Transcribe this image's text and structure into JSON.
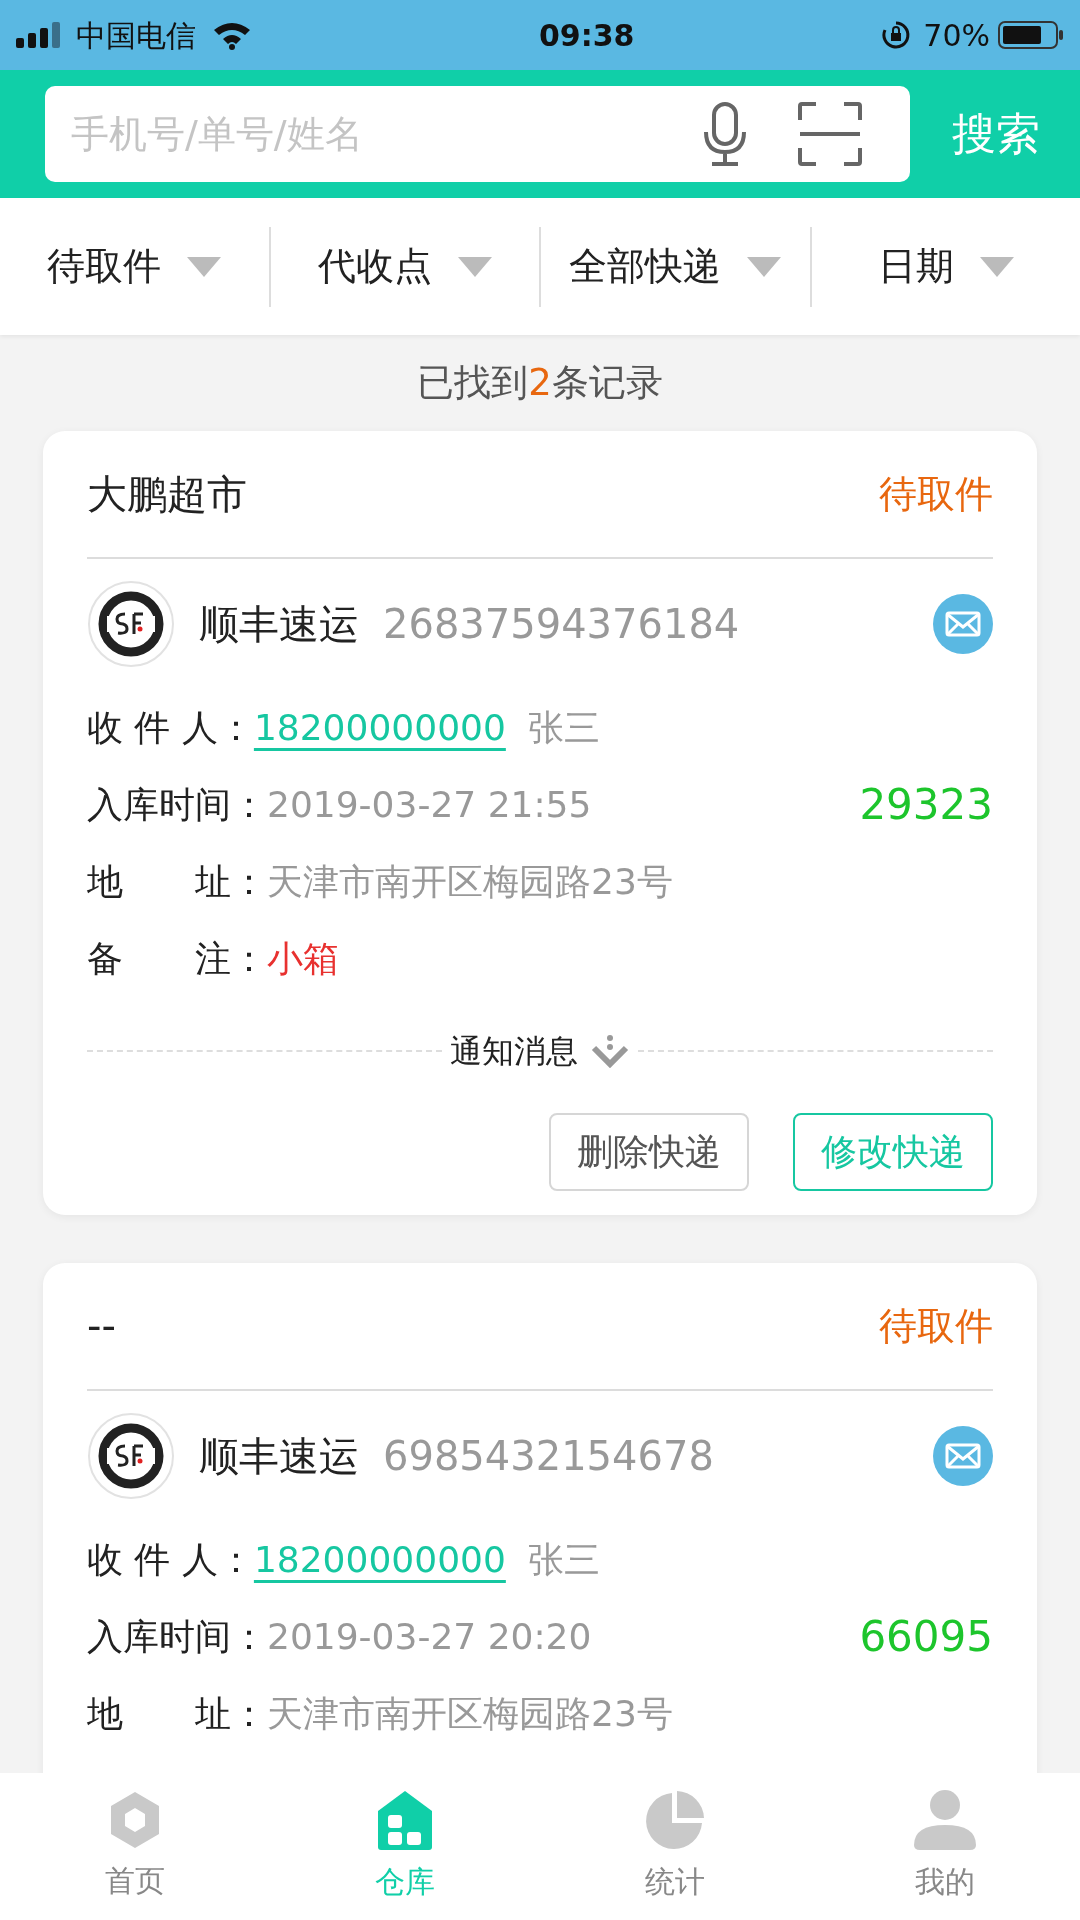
{
  "status_bar": {
    "carrier": "中国电信",
    "time": "09:38",
    "battery": "70%"
  },
  "search": {
    "placeholder": "手机号/单号/姓名",
    "button": "搜索"
  },
  "filters": [
    {
      "label": "待取件"
    },
    {
      "label": "代收点"
    },
    {
      "label": "全部快递"
    },
    {
      "label": "日期"
    }
  ],
  "result": {
    "prefix": "已找到",
    "count": "2",
    "suffix": "条记录"
  },
  "cards": [
    {
      "title": "大鹏超市",
      "status": "待取件",
      "courier": "顺丰速运",
      "tracking": "26837594376184",
      "fields": [
        {
          "kind": "recipient",
          "label": "收 件 人：",
          "phone": "18200000000",
          "name": "张三"
        },
        {
          "kind": "time",
          "label": "入库时间：",
          "value": "2019-03-27 21:55",
          "code": "29323"
        },
        {
          "kind": "plain",
          "label": "地　　址：",
          "value": "天津市南开区梅园路23号"
        },
        {
          "kind": "note",
          "label": "备　　注：",
          "value": "小箱"
        }
      ],
      "notice": "通知消息",
      "buttons": [
        {
          "label": "删除快递",
          "primary": false
        },
        {
          "label": "修改快递",
          "primary": true
        }
      ]
    },
    {
      "title": "--",
      "status": "待取件",
      "courier": "顺丰速运",
      "tracking": "6985432154678",
      "fields": [
        {
          "kind": "recipient",
          "label": "收 件 人：",
          "phone": "18200000000",
          "name": "张三"
        },
        {
          "kind": "time",
          "label": "入库时间：",
          "value": "2019-03-27 20:20",
          "code": "66095"
        },
        {
          "kind": "plain",
          "label": "地　　址：",
          "value": "天津市南开区梅园路23号"
        }
      ]
    }
  ],
  "nav": [
    {
      "label": "首页",
      "selected": false
    },
    {
      "label": "仓库",
      "selected": true
    },
    {
      "label": "统计",
      "selected": false
    },
    {
      "label": "我的",
      "selected": false
    }
  ]
}
